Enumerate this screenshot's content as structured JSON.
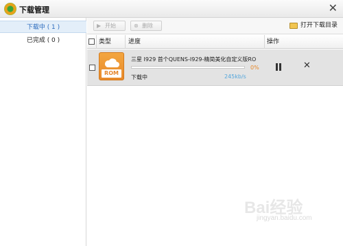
{
  "window": {
    "title": "下载管理",
    "close": "✕"
  },
  "sidebar": {
    "items": [
      {
        "label": "下载中 ( 1 )"
      },
      {
        "label": "已完成 ( 0 )"
      }
    ]
  },
  "toolbar": {
    "start_label": "开始",
    "delete_label": "删除",
    "open_dir_label": "打开下载目录"
  },
  "table": {
    "headers": {
      "type": "类型",
      "progress": "进度",
      "actions": "操作"
    },
    "rows": [
      {
        "type_badge": "ROM",
        "filename": "三星 I929 首个QUENS-I929-精简美化自定义版RO",
        "progress_percent": "0%",
        "status": "下载中",
        "speed": "245kb/s"
      }
    ]
  },
  "watermark": {
    "main": "Bai经验",
    "sub": "jingyan.baidu.com"
  },
  "colors": {
    "accent_blue": "#2b6bbd",
    "progress_orange": "#f09433",
    "speed_blue": "#53a6dc",
    "rom_orange": "#e8892a"
  }
}
